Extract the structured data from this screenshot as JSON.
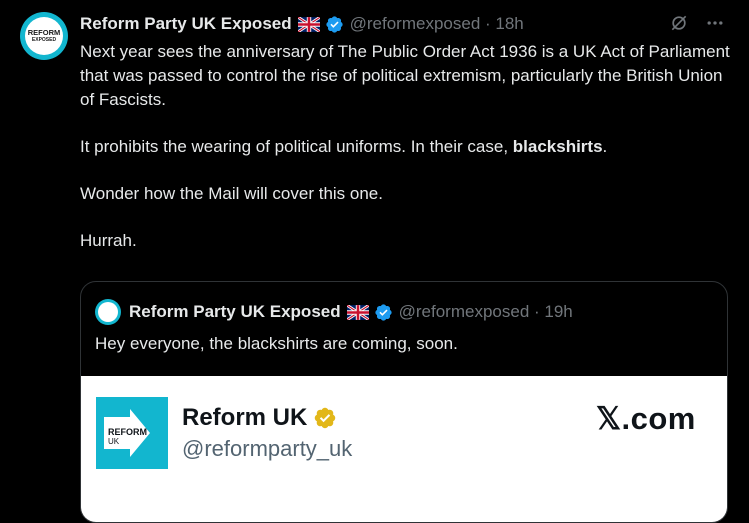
{
  "post": {
    "author_name": "Reform Party UK Exposed",
    "handle_time": "@reformexposed · 18h",
    "avatar_line1": "REFORM",
    "avatar_line2": "EXPOSED",
    "paragraphs": [
      "Next year sees the anniversary of The Public Order Act 1936 is a UK Act of Parliament that was passed to control the rise of political extremism, particularly the British Union of Fascists.",
      "It prohibits the wearing of political uniforms. In their case, ",
      "Wonder how the Mail will cover this one.",
      "Hurrah."
    ],
    "bold_word": "blackshirts",
    "bold_suffix": "."
  },
  "quote": {
    "author_name": "Reform Party UK Exposed",
    "handle_time": "@reformexposed · 19h",
    "text": "Hey everyone, the blackshirts are coming, soon."
  },
  "card": {
    "name": "Reform UK",
    "handle": "@reformparty_uk",
    "domain": "𝕏.com",
    "logo_line1": "REFORM",
    "logo_line2": "UK"
  },
  "colors": {
    "background": "#000000",
    "accent_verified": "#1d9bf0",
    "brand_teal": "#12b6cf",
    "muted_text": "#71767b"
  },
  "icons": [
    "grok-icon",
    "more-icon",
    "verified-icon",
    "uk-flag-icon"
  ]
}
